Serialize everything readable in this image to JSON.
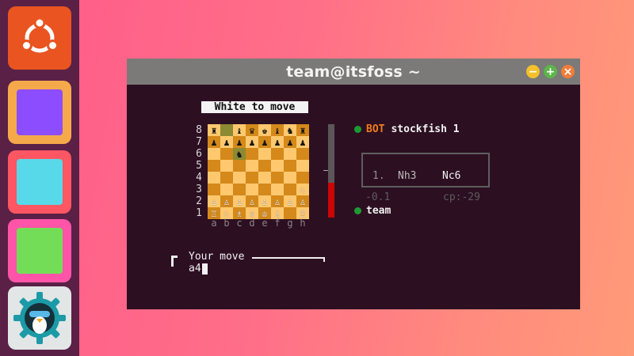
{
  "dock": {
    "items": [
      {
        "name": "ubuntu-launcher"
      },
      {
        "name": "app-purple",
        "color": "#8c4dff"
      },
      {
        "name": "app-cyan",
        "color": "#58d9ea"
      },
      {
        "name": "app-green",
        "color": "#74dd58"
      },
      {
        "name": "itsfoss-settings"
      }
    ]
  },
  "window": {
    "title": "team@itsfoss ~",
    "controls": [
      "minimize",
      "maximize",
      "close"
    ]
  },
  "game": {
    "turn": "White to move",
    "ranks": [
      "8",
      "7",
      "6",
      "5",
      "4",
      "3",
      "2",
      "1"
    ],
    "files": [
      "a",
      "b",
      "c",
      "d",
      "e",
      "f",
      "g",
      "h"
    ],
    "board": [
      [
        "♜",
        "",
        "♝",
        "♛",
        "♚",
        "♝",
        "♞",
        "♜"
      ],
      [
        "♟",
        "♟",
        "♟",
        "♟",
        "♟",
        "♟",
        "♟",
        "♟"
      ],
      [
        "",
        "",
        "♞",
        "",
        "",
        "",
        "",
        ""
      ],
      [
        "",
        "",
        "",
        "",
        "",
        "",
        "",
        ""
      ],
      [
        "",
        "",
        "",
        "",
        "",
        "",
        "",
        ""
      ],
      [
        "",
        "",
        "",
        "",
        "",
        "",
        "",
        "♘"
      ],
      [
        "♙",
        "♙",
        "♙",
        "♙",
        "♙",
        "♙",
        "♙",
        "♙"
      ],
      [
        "♖",
        "♘",
        "♗",
        "♕",
        "♔",
        "♗",
        "",
        "♖"
      ]
    ],
    "highlighted_squares": [
      "b8",
      "c6"
    ],
    "eval_bar_white_fraction": 0.37,
    "opponent": {
      "tag": "BOT",
      "name": "stockfish 1"
    },
    "player": {
      "name": "team"
    },
    "moves": [
      {
        "number": "1.",
        "white": "Nh3",
        "black": "Nc6"
      }
    ],
    "eval": "-0.1",
    "cp": "cp:-29",
    "input_label": "Your move",
    "input_value": "a4"
  },
  "colors": {
    "light_square": "#ffc86e",
    "dark_square": "#d4891a",
    "highlight": "#8c8a32",
    "eval_red": "#cc0505",
    "bot_orange": "#f27c1a",
    "status_green": "#1e9a32"
  }
}
